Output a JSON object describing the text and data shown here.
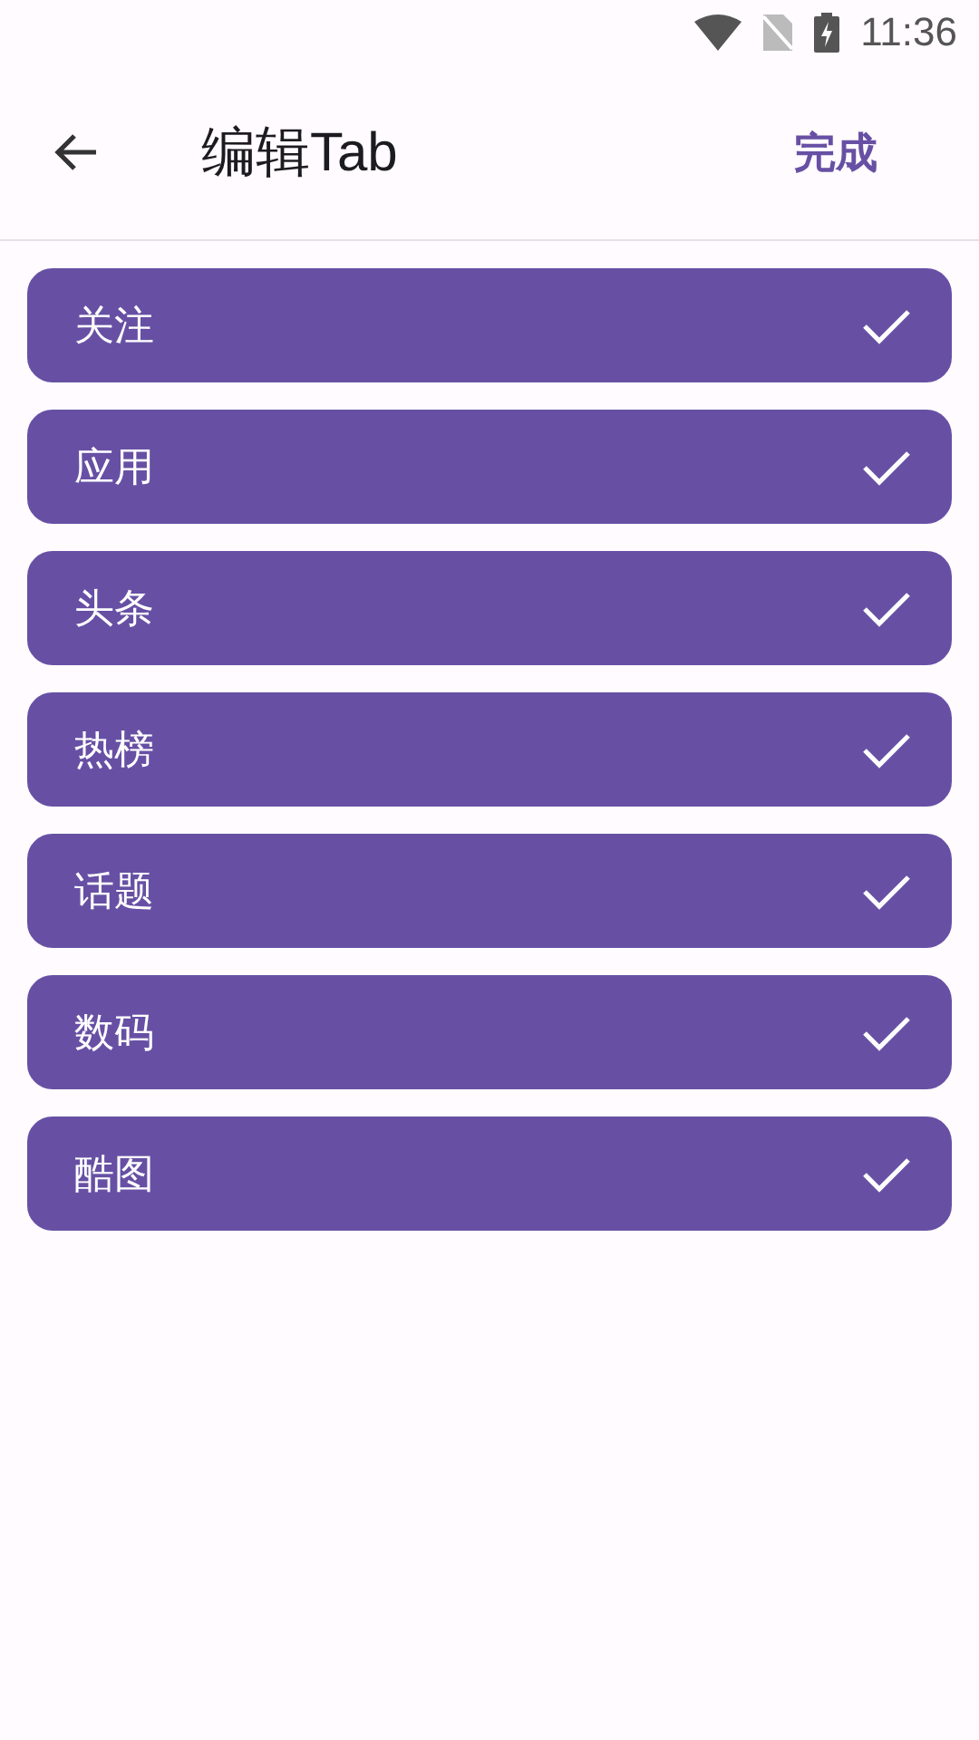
{
  "status_bar": {
    "time": "11:36"
  },
  "header": {
    "title": "编辑Tab",
    "action": "完成"
  },
  "tabs": [
    {
      "label": "关注",
      "checked": true
    },
    {
      "label": "应用",
      "checked": true
    },
    {
      "label": "头条",
      "checked": true
    },
    {
      "label": "热榜",
      "checked": true
    },
    {
      "label": "话题",
      "checked": true
    },
    {
      "label": "数码",
      "checked": true
    },
    {
      "label": "酷图",
      "checked": true
    }
  ]
}
